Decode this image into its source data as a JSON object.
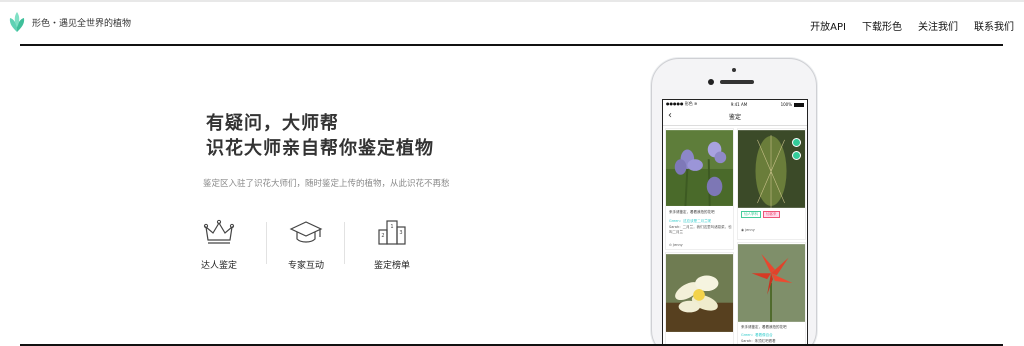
{
  "header": {
    "brand": "形色・遇见全世界的植物",
    "nav": [
      "开放API",
      "下载形色",
      "关注我们",
      "联系我们"
    ]
  },
  "hero": {
    "title_line1": "有疑问，大师帮",
    "title_line2": "识花大师亲自帮你鉴定植物",
    "subtitle": "鉴定区入驻了识花大师们，随时鉴定上传的植物，从此识花不再愁"
  },
  "features": [
    {
      "label": "达人鉴定",
      "icon": "crown-icon"
    },
    {
      "label": "专家互动",
      "icon": "graduation-cap-icon"
    },
    {
      "label": "鉴定榜单",
      "icon": "podium-icon"
    }
  ],
  "phone": {
    "status_left": "●●●●● 形色 ≋",
    "status_time": "9:41 AM",
    "status_right": "100%",
    "screen_title": "鉴定",
    "card1": {
      "caption": "来手请鉴定，看看我拍的花吧",
      "line1": "Green：这应该是二月兰呢",
      "line2": "Sarah：二月兰，我们这里叫诸葛菜，也叫二月兰"
    },
    "card2": {
      "tags": [
        "仙人掌科",
        "仙客来"
      ],
      "user": "jenny"
    },
    "card1_user": "Jenny",
    "card4": {
      "caption": "来手请鉴定，看看我拍的花吧",
      "line1": "Green：看着像百合",
      "line2": "Sarah：朱顶红吧看着"
    }
  }
}
